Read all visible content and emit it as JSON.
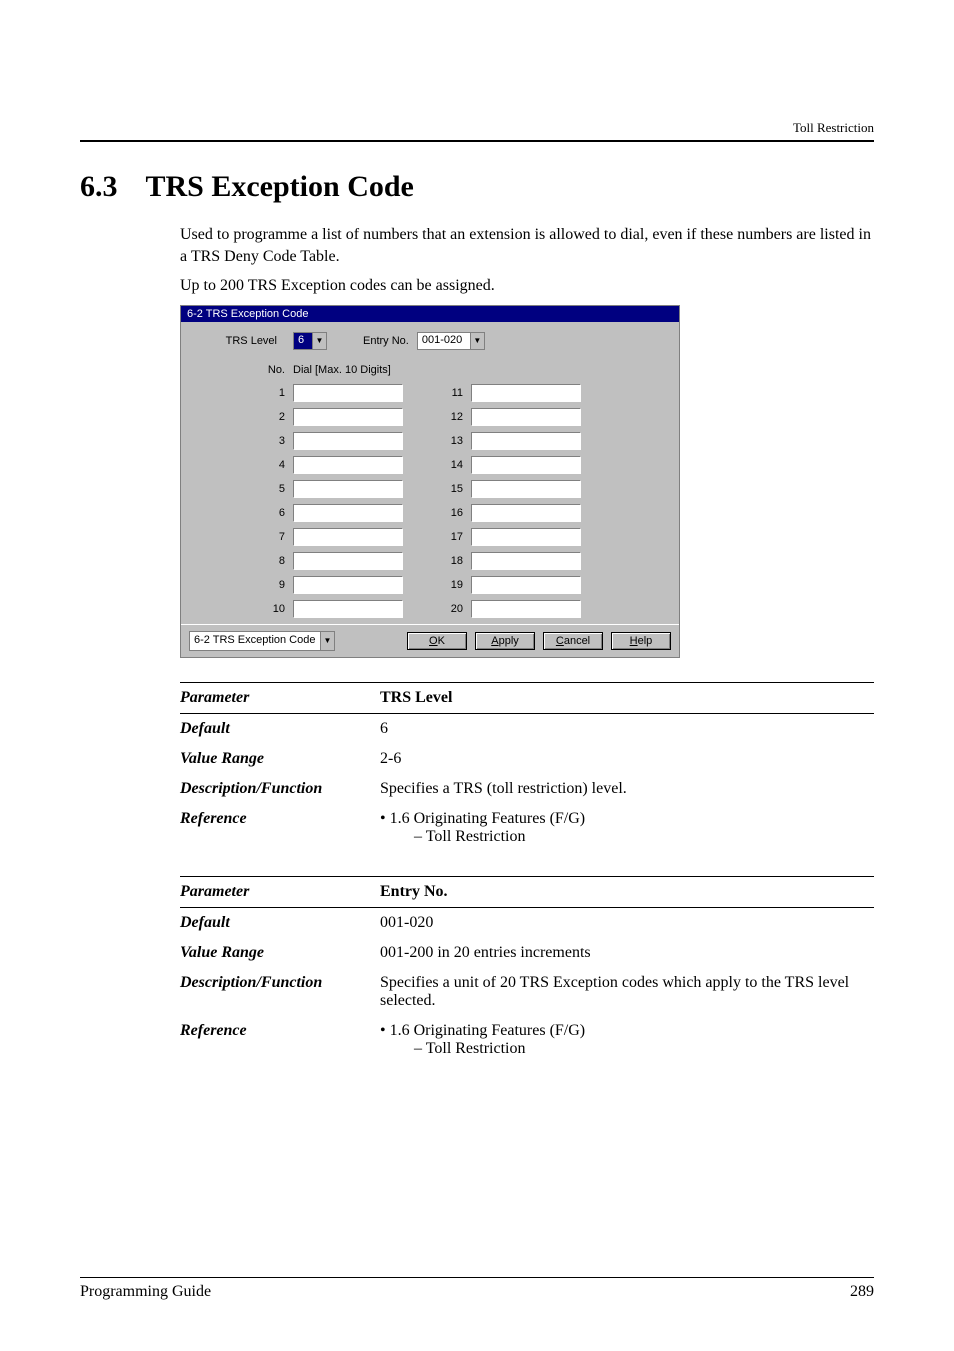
{
  "header": {
    "section_label": "Toll Restriction"
  },
  "title": {
    "number": "6.3",
    "text": "TRS Exception Code"
  },
  "intro": {
    "p1": "Used to programme a list of numbers that an extension is allowed to dial, even if these numbers are listed in a TRS Deny Code Table.",
    "p2": "Up to 200 TRS Exception codes can be assigned."
  },
  "dialog": {
    "title": "6-2 TRS Exception Code",
    "trs_level_label": "TRS Level",
    "trs_level_value": "6",
    "entry_no_label": "Entry No.",
    "entry_no_value": "001-020",
    "grid_header_no": "No.",
    "grid_header_dial": "Dial [Max. 10 Digits]",
    "rows_left": [
      "1",
      "2",
      "3",
      "4",
      "5",
      "6",
      "7",
      "8",
      "9",
      "10"
    ],
    "rows_right": [
      "11",
      "12",
      "13",
      "14",
      "15",
      "16",
      "17",
      "18",
      "19",
      "20"
    ],
    "footer_select_value": "6-2 TRS Exception Code",
    "buttons": {
      "ok": "OK",
      "apply": "Apply",
      "cancel": "Cancel",
      "help": "Help"
    }
  },
  "params": [
    {
      "name": "TRS Level",
      "default": "6",
      "value_range": "2-6",
      "desc": "Specifies a TRS (toll restriction) level.",
      "ref_line1": "• 1.6 Originating Features (F/G)",
      "ref_line2": "– Toll Restriction"
    },
    {
      "name": "Entry No.",
      "default": "001-020",
      "value_range": "001-200 in 20 entries increments",
      "desc": "Specifies a unit of 20 TRS Exception codes which apply to the TRS level selected.",
      "ref_line1": "• 1.6 Originating Features (F/G)",
      "ref_line2": "– Toll Restriction"
    }
  ],
  "labels": {
    "parameter": "Parameter",
    "default": "Default",
    "value_range": "Value Range",
    "description_function": "Description/Function",
    "reference": "Reference"
  },
  "footer": {
    "guide": "Programming Guide",
    "page": "289"
  }
}
